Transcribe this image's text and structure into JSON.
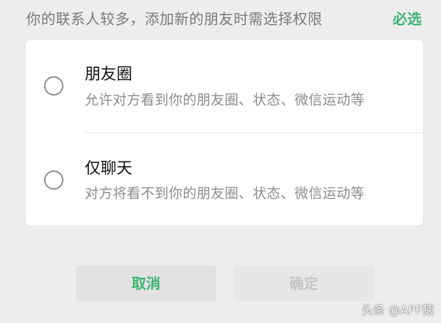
{
  "header": {
    "note": "你的联系人较多，添加新的朋友时需选择权限",
    "required_label": "必选"
  },
  "options": [
    {
      "title": "朋友圈",
      "description": "允许对方看到你的朋友圈、状态、微信运动等",
      "selected": false
    },
    {
      "title": "仅聊天",
      "description": "对方将看不到你的朋友圈、状态、微信运动等",
      "selected": false
    }
  ],
  "buttons": {
    "cancel_label": "取消",
    "confirm_label": "确定",
    "confirm_enabled": false
  },
  "watermark": "头条 @APP猿",
  "colors": {
    "accent": "#3cb371",
    "background": "#ededed",
    "card": "#ffffff",
    "disabled_text": "#c4c4c4"
  }
}
